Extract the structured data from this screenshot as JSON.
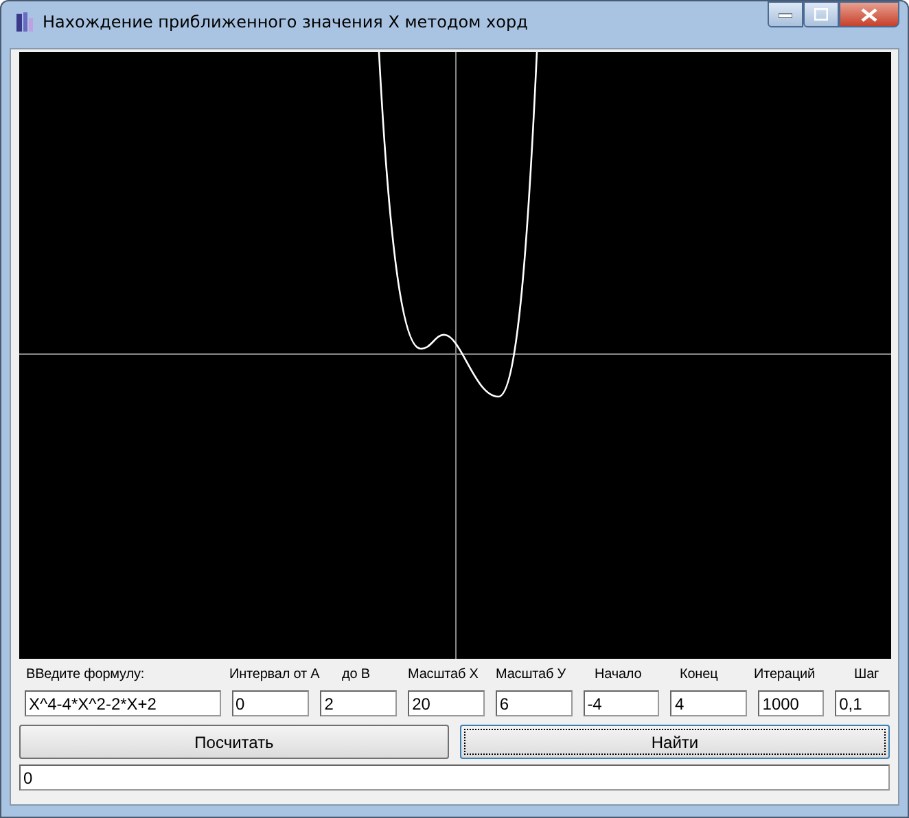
{
  "window": {
    "title": "Нахождение приближенного значения X методом хорд"
  },
  "formula": {
    "label": "ВВедите формулу:",
    "value": "X^4-4*X^2-2*X+2"
  },
  "fields": [
    {
      "label": "Интервал от А",
      "value": "0"
    },
    {
      "label": "до В",
      "value": "2"
    },
    {
      "label": "Масштаб  X",
      "value": "20"
    },
    {
      "label": "Масштаб  У",
      "value": "6"
    },
    {
      "label": "Начало",
      "value": "-4"
    },
    {
      "label": "Конец",
      "value": "4"
    },
    {
      "label": "Итераций",
      "value": "1000"
    },
    {
      "label": "Шаг",
      "value": "0,1"
    }
  ],
  "buttons": [
    {
      "label": "Посчитать",
      "focused": false
    },
    {
      "label": "Найти",
      "focused": true
    }
  ],
  "output": {
    "value": "0"
  }
}
